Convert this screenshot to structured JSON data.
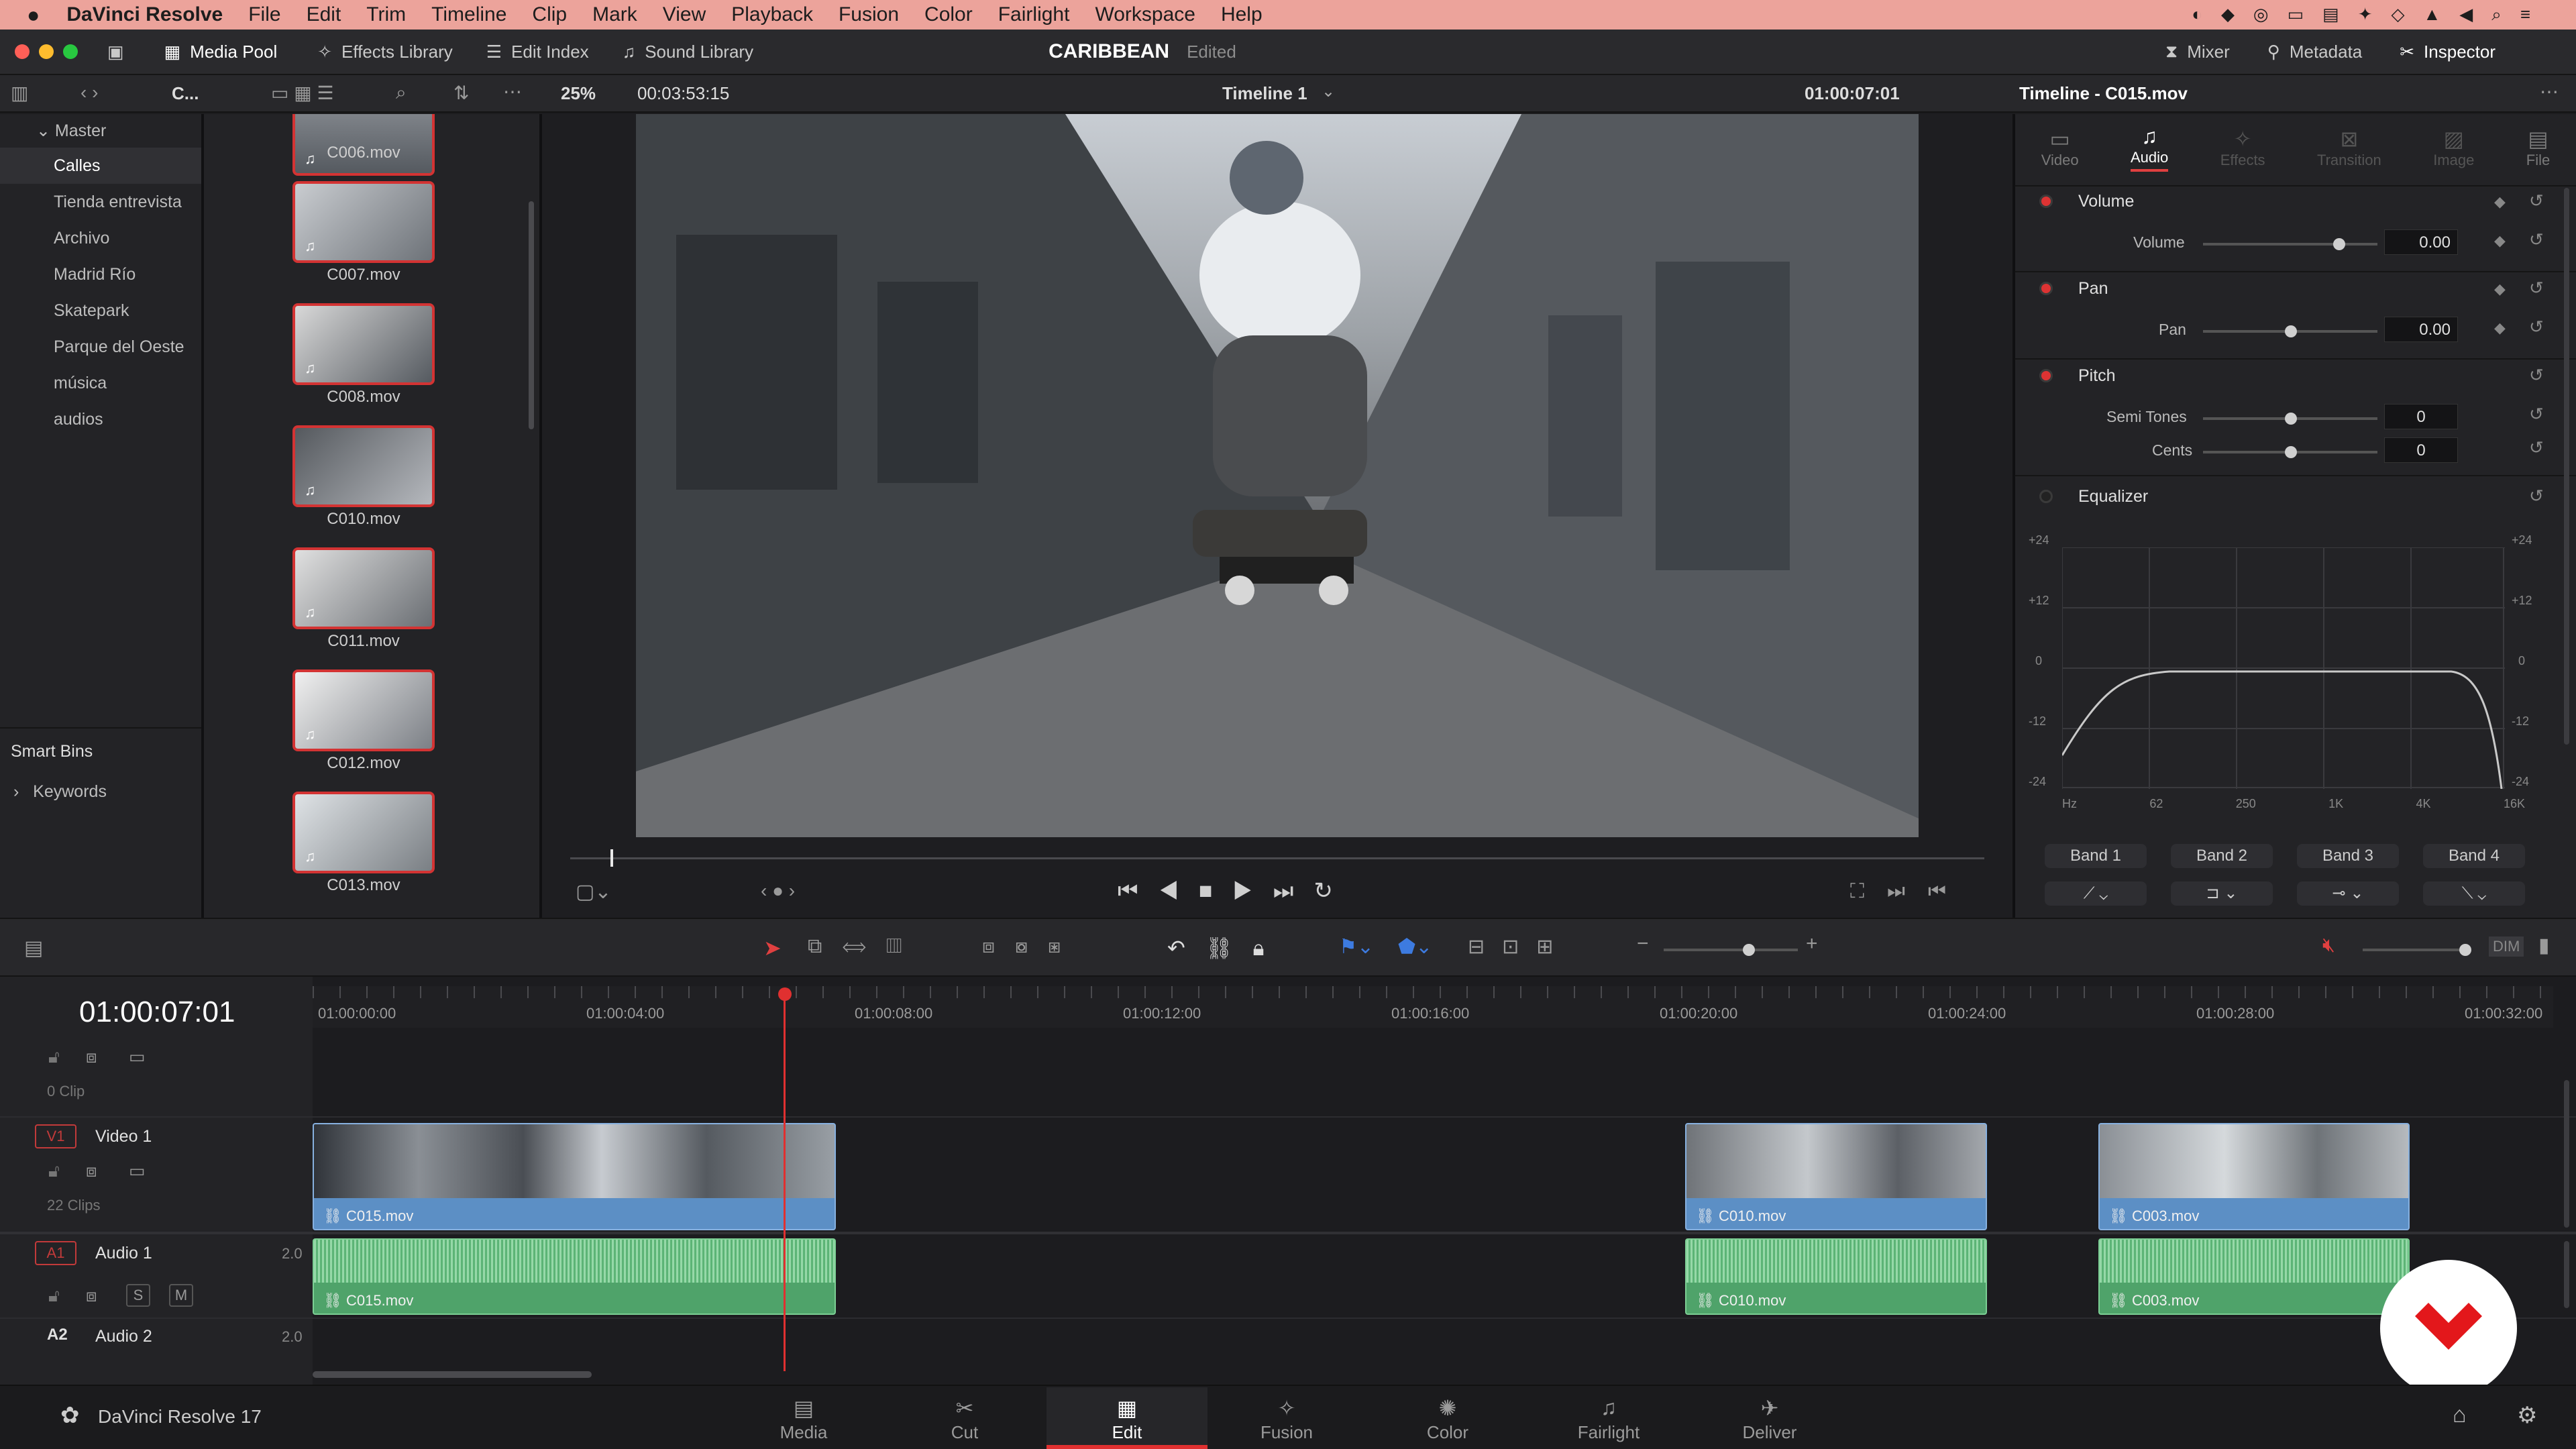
{
  "menubar": {
    "apple": "",
    "app": "DaVinci Resolve",
    "items": [
      "File",
      "Edit",
      "Trim",
      "Timeline",
      "Clip",
      "Mark",
      "View",
      "Playback",
      "Fusion",
      "Color",
      "Fairlight",
      "Workspace",
      "Help"
    ]
  },
  "toolbar": {
    "media_pool": "Media Pool",
    "effects_library": "Effects Library",
    "edit_index": "Edit Index",
    "sound_library": "Sound Library",
    "project": "CARIBBEAN",
    "status": "Edited",
    "mixer": "Mixer",
    "metadata": "Metadata",
    "inspector": "Inspector"
  },
  "viewer_bar": {
    "bin_short": "C...",
    "zoom": "25%",
    "timecode_dur": "00:03:53:15",
    "timeline_name": "Timeline 1",
    "timecode_pos": "01:00:07:01",
    "inspector_title": "Timeline - C015.mov"
  },
  "bins": {
    "root": "Master",
    "items": [
      "Calles",
      "Tienda entrevista",
      "Archivo",
      "Madrid Río",
      "Skatepark",
      "Parque del Oeste",
      "música",
      "audios"
    ],
    "smart_bins": "Smart Bins",
    "keywords": "Keywords"
  },
  "clips": [
    "C006.mov",
    "C007.mov",
    "C008.mov",
    "C010.mov",
    "C011.mov",
    "C012.mov",
    "C013.mov"
  ],
  "inspector": {
    "tabs": [
      "Video",
      "Audio",
      "Effects",
      "Transition",
      "Image",
      "File"
    ],
    "volume": {
      "section": "Volume",
      "label": "Volume",
      "value": "0.00"
    },
    "pan": {
      "section": "Pan",
      "label": "Pan",
      "value": "0.00"
    },
    "pitch": {
      "section": "Pitch",
      "semi_label": "Semi Tones",
      "semi": "0",
      "cents_label": "Cents",
      "cents": "0"
    },
    "equalizer": {
      "section": "Equalizer",
      "y_ticks": [
        "+24",
        "+12",
        "0",
        "-12",
        "-24"
      ],
      "x_ticks": [
        "Hz",
        "62",
        "250",
        "1K",
        "4K",
        "16K"
      ],
      "bands": [
        "Band 1",
        "Band 2",
        "Band 3",
        "Band 4"
      ]
    }
  },
  "timeline": {
    "timecode": "01:00:07:01",
    "ruler": [
      "01:00:00:00",
      "01:00:04:00",
      "01:00:08:00",
      "01:00:12:00",
      "01:00:16:00",
      "01:00:20:00",
      "01:00:24:00",
      "01:00:28:00",
      "01:00:32:00"
    ],
    "tracks": {
      "v2_info": "0 Clip",
      "v1_tag": "V1",
      "v1_name": "Video 1",
      "v1_info": "22 Clips",
      "a1_tag": "A1",
      "a1_name": "Audio 1",
      "a1_ch": "2.0",
      "a2_tag": "A2",
      "a2_name": "Audio 2",
      "a2_ch": "2.0",
      "solo": "S",
      "mute": "M"
    },
    "video_clips": [
      "C015.mov",
      "C010.mov",
      "C003.mov"
    ],
    "audio_clips": [
      "C015.mov",
      "C010.mov",
      "C003.mov"
    ]
  },
  "footer": {
    "app_name": "DaVinci Resolve 17",
    "pages": [
      "Media",
      "Cut",
      "Edit",
      "Fusion",
      "Color",
      "Fairlight",
      "Deliver"
    ],
    "active_page": "Edit"
  },
  "colors": {
    "menubar": "#eca39b",
    "accent": "#d33333",
    "video_clip": "#5c8fc5",
    "audio_clip": "#4fa36a",
    "playhead": "#e03030"
  }
}
